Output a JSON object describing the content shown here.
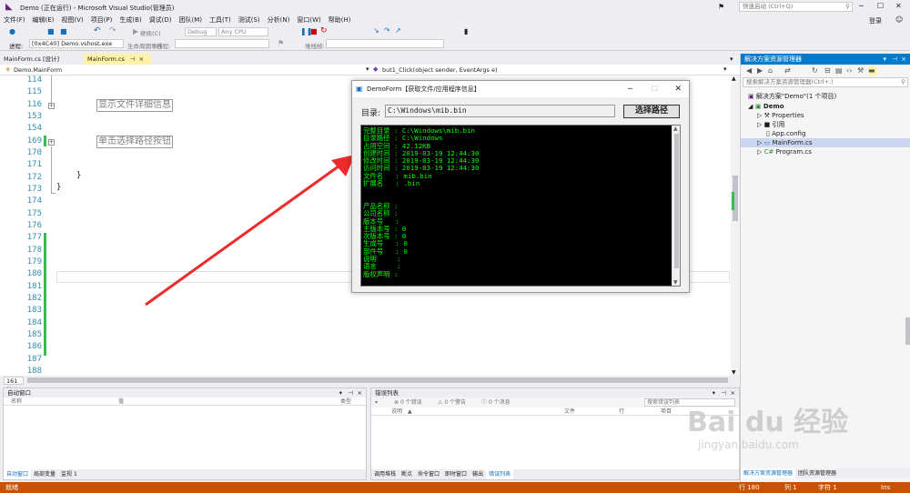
{
  "window": {
    "title": "Demo (正在运行) - Microsoft Visual Studio(管理员)",
    "quick_launch": "快速启动 (Ctrl+Q)",
    "login": "登录"
  },
  "menu": [
    "文件(F)",
    "编辑(E)",
    "视图(V)",
    "项目(P)",
    "生成(B)",
    "调试(D)",
    "团队(M)",
    "工具(T)",
    "测试(S)",
    "分析(N)",
    "窗口(W)",
    "帮助(H)"
  ],
  "toolbar": {
    "continue": "继续(C)",
    "debug_config": "Debug",
    "platform": "Any CPU"
  },
  "toolbar2": {
    "process_label": "进程:",
    "process_value": "[0x4C40] Demo.vshost.exe",
    "lifecycle_label": "生命周期事件",
    "thread_label": "线程:",
    "stack_label": "堆栈帧:"
  },
  "doc_tabs": {
    "tab1": "MainForm.cs [设计]",
    "tab2": "MainForm.cs"
  },
  "nav_bar": {
    "left": "Demo.MainForm",
    "right": "but1_Click(object sender, EventArgs e)"
  },
  "editor": {
    "lines": [
      "114",
      "115",
      "116",
      "153",
      "154",
      "169",
      "170",
      "171",
      "172",
      "173",
      "174",
      "175",
      "176",
      "177",
      "178",
      "179",
      "180",
      "181",
      "182",
      "183",
      "184",
      "185",
      "186",
      "187",
      "188"
    ],
    "region1": "显示文件详细信息",
    "region2": "单击选择路径按钮",
    "brace1": "}",
    "brace2": "}",
    "zoom": "161 %"
  },
  "form": {
    "title": "DemoForm【获取文件/应用程序信息】",
    "dir_label": "目录:",
    "dir_value": "C:\\Windows\\mib.bin",
    "button": "选择路径",
    "console": [
      "完整目录 : C:\\Windows\\mib.bin",
      "目录路径 : C:\\Windows",
      "占用空间 : 42.12KB",
      "创建时间 : 2019-03-19 12:44:30",
      "修改时间 : 2019-03-19 12:44:30",
      "访问时间 : 2019-03-19 12:44:30",
      "文件名   : mib.bin",
      "扩展名   : .bin",
      "",
      "",
      "产品名称 :",
      "公司名称 :",
      "版本号   :",
      "主版本号 : 0",
      "次版本号 : 0",
      "生成号   : 0",
      "部件号   : 0",
      "说明     :",
      "语言     :",
      "版权声明 :"
    ]
  },
  "auto_window": {
    "title": "自动窗口",
    "col_name": "名称",
    "col_value": "值",
    "col_type": "类型",
    "tabs": [
      "自动窗口",
      "局部变量",
      "监视 1"
    ]
  },
  "error_list": {
    "title": "错误列表",
    "errors": "0 个错误",
    "warnings": "0 个警告",
    "messages": "0 个消息",
    "search": "搜索错误列表",
    "col_desc": "说明",
    "col_file": "文件",
    "col_line": "行",
    "col_project": "项目",
    "tabs": [
      "调用堆栈",
      "断点",
      "命令窗口",
      "即时窗口",
      "输出",
      "错误列表"
    ]
  },
  "solution": {
    "title": "解决方案资源管理器",
    "search": "搜索解决方案资源管理器(Ctrl+;)",
    "items": [
      "解决方案\"Demo\"(1 个项目)",
      "Demo",
      "Properties",
      "引用",
      "App.config",
      "MainForm.cs",
      "Program.cs"
    ],
    "tabs": [
      "解决方案资源管理器",
      "团队资源管理器"
    ]
  },
  "status": {
    "ready": "就绪",
    "line": "行 180",
    "col": "列 1",
    "char": "字符 1",
    "ins": "Ins"
  },
  "watermark": {
    "brand": "Bai du 经验",
    "url": "jingyan.baidu.com"
  }
}
